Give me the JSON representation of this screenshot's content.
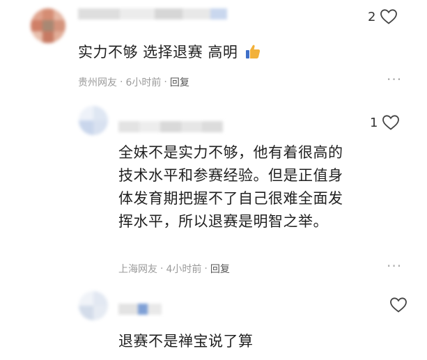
{
  "comments": [
    {
      "likes": "2",
      "text_lines": [
        "实力不够 选择退赛 高明"
      ],
      "emoji": "thumbs-up",
      "location": "贵州网友",
      "time": "6小时前",
      "reply_label": "回复"
    },
    {
      "likes": "1",
      "text_lines": [
        "全妹不是实力不够，他有着很高的",
        "技术水平和参赛经验。但是正值身",
        "体发育期把握不了自己很难全面发",
        "挥水平，所以退赛是明智之举。"
      ],
      "location": "上海网友",
      "time": "4小时前",
      "reply_label": "回复"
    },
    {
      "likes": "",
      "text_lines": [
        "退赛不是禅宝说了算"
      ]
    }
  ],
  "icons": {
    "heart": "heart-outline-icon",
    "more": "more-dots-icon"
  },
  "colors": {
    "accent_thumb": "#4a7fd8",
    "meta_gray": "#9a9a9a"
  }
}
